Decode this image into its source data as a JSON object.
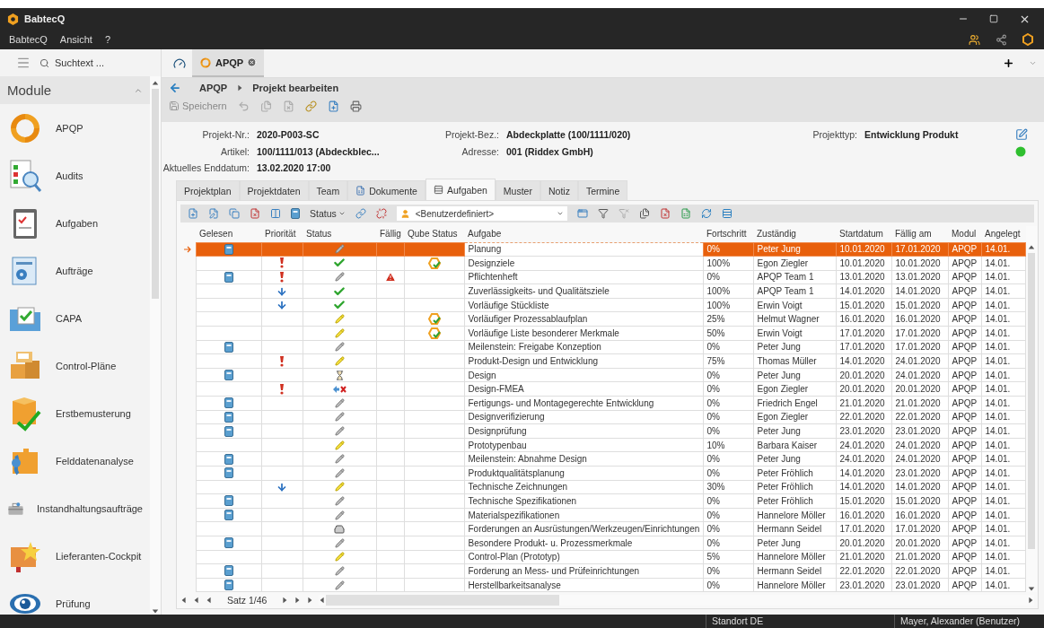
{
  "window": {
    "title": "BabtecQ"
  },
  "menu": [
    "BabtecQ",
    "Ansicht",
    "?"
  ],
  "sidebar": {
    "search_placeholder": "Suchtext ...",
    "header": "Module",
    "items": [
      "APQP",
      "Audits",
      "Aufgaben",
      "Aufträge",
      "CAPA",
      "Control-Pläne",
      "Erstbemusterung",
      "Felddatenanalyse",
      "Instandhaltungsaufträge",
      "Lieferanten-Cockpit",
      "Prüfung"
    ]
  },
  "doc_tabs": [
    {
      "label": "APQP",
      "selected": true
    }
  ],
  "breadcrumb": [
    "APQP",
    "Projekt bearbeiten"
  ],
  "toolbar": {
    "save": "Speichern"
  },
  "project": {
    "rows": [
      [
        {
          "label": "Projekt-Nr.:",
          "value": "2020-P003-SC"
        },
        {
          "label": "Projekt-Bez.:",
          "value": "Abdeckplatte (100/1111/020)"
        },
        {
          "label": "Projekttyp:",
          "value": "Entwicklung Produkt"
        }
      ],
      [
        {
          "label": "Artikel:",
          "value": "100/1111/013 (Abdeckblec..."
        },
        {
          "label": "Adresse:",
          "value": "001 (Riddex GmbH)"
        }
      ],
      [
        {
          "label": "Aktuelles Enddatum:",
          "value": "13.02.2020 17:00"
        }
      ]
    ]
  },
  "tabs": [
    {
      "label": "Projektplan",
      "selected": false
    },
    {
      "label": "Projektdaten",
      "selected": false
    },
    {
      "label": "Team",
      "selected": false
    },
    {
      "label": "Dokumente",
      "selected": false
    },
    {
      "label": "Aufgaben",
      "selected": true
    },
    {
      "label": "Muster",
      "selected": false
    },
    {
      "label": "Notiz",
      "selected": false
    },
    {
      "label": "Termine",
      "selected": false
    }
  ],
  "grid": {
    "status_menu": "Status",
    "filter": "<Benutzerdefiniert>",
    "pager": "Satz 1/46",
    "columns": [
      "Gelesen",
      "Priorität",
      "Status",
      "Fällig",
      "Qube Status",
      "Aufgabe",
      "Fortschritt",
      "Zuständig",
      "Startdatum",
      "Fällig am",
      "Modul",
      "Angelegt"
    ],
    "rows": [
      {
        "selected": true,
        "read": true,
        "status": {
          "kind": "open"
        },
        "overdue": false,
        "qube": false,
        "task": "Planung",
        "progress": "0%",
        "assignee": "Peter Jung",
        "start": "10.01.2020",
        "due": "17.01.2020",
        "module": "APQP",
        "created": "14.01."
      },
      {
        "selected": false,
        "read": false,
        "priority": {
          "kind": "high"
        },
        "status": {
          "kind": "done"
        },
        "overdue": false,
        "qube": true,
        "task": "Designziele",
        "progress": "100%",
        "assignee": "Egon Ziegler",
        "start": "10.01.2020",
        "due": "10.01.2020",
        "module": "APQP",
        "created": "14.01."
      },
      {
        "selected": false,
        "read": true,
        "priority": {
          "kind": "high"
        },
        "status": {
          "kind": "open"
        },
        "overdue": true,
        "qube": false,
        "task": "Pflichtenheft",
        "progress": "0%",
        "assignee": "APQP Team 1",
        "start": "13.01.2020",
        "due": "13.01.2020",
        "module": "APQP",
        "created": "14.01."
      },
      {
        "selected": false,
        "read": false,
        "priority": {
          "kind": "low"
        },
        "status": {
          "kind": "done"
        },
        "overdue": false,
        "qube": false,
        "task": "Zuverlässigkeits- und Qualitätsziele",
        "progress": "100%",
        "assignee": "APQP Team 1",
        "start": "14.01.2020",
        "due": "14.01.2020",
        "module": "APQP",
        "created": "14.01."
      },
      {
        "selected": false,
        "read": false,
        "priority": {
          "kind": "low"
        },
        "status": {
          "kind": "done"
        },
        "overdue": false,
        "qube": false,
        "task": "Vorläufige Stückliste",
        "progress": "100%",
        "assignee": "Erwin Voigt",
        "start": "15.01.2020",
        "due": "15.01.2020",
        "module": "APQP",
        "created": "14.01."
      },
      {
        "selected": false,
        "read": false,
        "status": {
          "kind": "in_progress"
        },
        "overdue": false,
        "qube": true,
        "task": "Vorläufiger Prozessablaufplan",
        "progress": "25%",
        "assignee": "Helmut Wagner",
        "start": "16.01.2020",
        "due": "16.01.2020",
        "module": "APQP",
        "created": "14.01."
      },
      {
        "selected": false,
        "read": false,
        "status": {
          "kind": "in_progress"
        },
        "overdue": false,
        "qube": true,
        "task": "Vorläufige Liste besonderer Merkmale",
        "progress": "50%",
        "assignee": "Erwin Voigt",
        "start": "17.01.2020",
        "due": "17.01.2020",
        "module": "APQP",
        "created": "14.01."
      },
      {
        "selected": false,
        "read": true,
        "status": {
          "kind": "open"
        },
        "overdue": false,
        "qube": false,
        "task": "Meilenstein: Freigabe Konzeption",
        "progress": "0%",
        "assignee": "Peter Jung",
        "start": "17.01.2020",
        "due": "17.01.2020",
        "module": "APQP",
        "created": "14.01."
      },
      {
        "selected": false,
        "read": false,
        "priority": {
          "kind": "high"
        },
        "status": {
          "kind": "in_progress"
        },
        "overdue": false,
        "qube": false,
        "task": "Produkt-Design und Entwicklung",
        "progress": "75%",
        "assignee": "Thomas Müller",
        "start": "14.01.2020",
        "due": "24.01.2020",
        "module": "APQP",
        "created": "14.01."
      },
      {
        "selected": false,
        "read": true,
        "status": {
          "kind": "waiting"
        },
        "overdue": false,
        "qube": false,
        "task": "Design",
        "progress": "0%",
        "assignee": "Peter Jung",
        "start": "20.01.2020",
        "due": "24.01.2020",
        "module": "APQP",
        "created": "14.01."
      },
      {
        "selected": false,
        "read": false,
        "priority": {
          "kind": "high"
        },
        "status": {
          "kind": "rejected"
        },
        "overdue": false,
        "qube": false,
        "task": "Design-FMEA",
        "progress": "0%",
        "assignee": "Egon Ziegler",
        "start": "20.01.2020",
        "due": "20.01.2020",
        "module": "APQP",
        "created": "14.01."
      },
      {
        "selected": false,
        "read": true,
        "status": {
          "kind": "open"
        },
        "overdue": false,
        "qube": false,
        "task": "Fertigungs- und Montagegerechte Entwicklung",
        "progress": "0%",
        "assignee": "Friedrich Engel",
        "start": "21.01.2020",
        "due": "21.01.2020",
        "module": "APQP",
        "created": "14.01."
      },
      {
        "selected": false,
        "read": true,
        "status": {
          "kind": "open"
        },
        "overdue": false,
        "qube": false,
        "task": "Designverifizierung",
        "progress": "0%",
        "assignee": "Egon Ziegler",
        "start": "22.01.2020",
        "due": "22.01.2020",
        "module": "APQP",
        "created": "14.01."
      },
      {
        "selected": false,
        "read": true,
        "status": {
          "kind": "open"
        },
        "overdue": false,
        "qube": false,
        "task": "Designprüfung",
        "progress": "0%",
        "assignee": "Peter Jung",
        "start": "23.01.2020",
        "due": "23.01.2020",
        "module": "APQP",
        "created": "14.01."
      },
      {
        "selected": false,
        "read": false,
        "status": {
          "kind": "in_progress"
        },
        "overdue": false,
        "qube": false,
        "task": "Prototypenbau",
        "progress": "10%",
        "assignee": "Barbara Kaiser",
        "start": "24.01.2020",
        "due": "24.01.2020",
        "module": "APQP",
        "created": "14.01."
      },
      {
        "selected": false,
        "read": true,
        "status": {
          "kind": "open"
        },
        "overdue": false,
        "qube": false,
        "task": "Meilenstein: Abnahme Design",
        "progress": "0%",
        "assignee": "Peter Jung",
        "start": "24.01.2020",
        "due": "24.01.2020",
        "module": "APQP",
        "created": "14.01."
      },
      {
        "selected": false,
        "read": true,
        "status": {
          "kind": "open"
        },
        "overdue": false,
        "qube": false,
        "task": "Produktqualitätsplanung",
        "progress": "0%",
        "assignee": "Peter Fröhlich",
        "start": "14.01.2020",
        "due": "23.01.2020",
        "module": "APQP",
        "created": "14.01."
      },
      {
        "selected": false,
        "read": false,
        "priority": {
          "kind": "low"
        },
        "status": {
          "kind": "in_progress"
        },
        "overdue": false,
        "qube": false,
        "task": "Technische Zeichnungen",
        "progress": "30%",
        "assignee": "Peter Fröhlich",
        "start": "14.01.2020",
        "due": "14.01.2020",
        "module": "APQP",
        "created": "14.01."
      },
      {
        "selected": false,
        "read": true,
        "status": {
          "kind": "open"
        },
        "overdue": false,
        "qube": false,
        "task": "Technische Spezifikationen",
        "progress": "0%",
        "assignee": "Peter Fröhlich",
        "start": "15.01.2020",
        "due": "15.01.2020",
        "module": "APQP",
        "created": "14.01."
      },
      {
        "selected": false,
        "read": true,
        "status": {
          "kind": "open"
        },
        "overdue": false,
        "qube": false,
        "task": "Materialspezifikationen",
        "progress": "0%",
        "assignee": "Hannelore Möller",
        "start": "16.01.2020",
        "due": "16.01.2020",
        "module": "APQP",
        "created": "14.01."
      },
      {
        "selected": false,
        "read": false,
        "status": {
          "kind": "on_hold"
        },
        "overdue": false,
        "qube": false,
        "task": "Forderungen an Ausrüstungen/Werkzeugen/Einrichtungen",
        "progress": "0%",
        "assignee": "Hermann Seidel",
        "start": "17.01.2020",
        "due": "17.01.2020",
        "module": "APQP",
        "created": "14.01."
      },
      {
        "selected": false,
        "read": true,
        "status": {
          "kind": "open"
        },
        "overdue": false,
        "qube": false,
        "task": "Besondere Produkt- u. Prozessmerkmale",
        "progress": "0%",
        "assignee": "Peter Jung",
        "start": "20.01.2020",
        "due": "20.01.2020",
        "module": "APQP",
        "created": "14.01."
      },
      {
        "selected": false,
        "read": false,
        "status": {
          "kind": "in_progress"
        },
        "overdue": false,
        "qube": false,
        "task": "Control-Plan (Prototyp)",
        "progress": "5%",
        "assignee": "Hannelore Möller",
        "start": "21.01.2020",
        "due": "21.01.2020",
        "module": "APQP",
        "created": "14.01."
      },
      {
        "selected": false,
        "read": true,
        "status": {
          "kind": "open"
        },
        "overdue": false,
        "qube": false,
        "task": "Forderung an Mess- und Prüfeinrichtungen",
        "progress": "0%",
        "assignee": "Hermann Seidel",
        "start": "22.01.2020",
        "due": "22.01.2020",
        "module": "APQP",
        "created": "14.01."
      },
      {
        "selected": false,
        "read": true,
        "status": {
          "kind": "open"
        },
        "overdue": false,
        "qube": false,
        "task": "Herstellbarkeitsanalyse",
        "progress": "0%",
        "assignee": "Hannelore Möller",
        "start": "23.01.2020",
        "due": "23.01.2020",
        "module": "APQP",
        "created": "14.01."
      }
    ]
  },
  "status_bar": [
    "Standort DE",
    "Mayer, Alexander (Benutzer)"
  ]
}
